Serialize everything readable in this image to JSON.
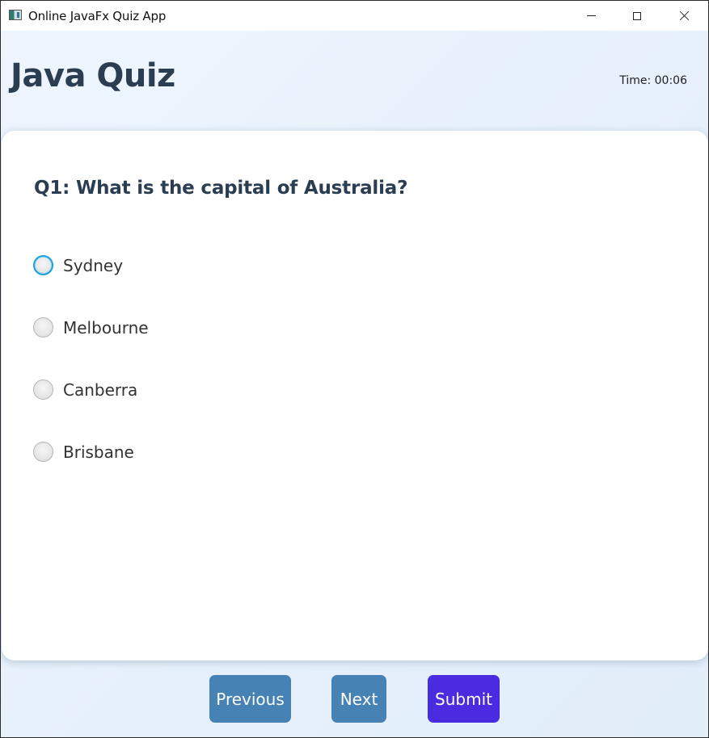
{
  "window": {
    "title": "Online JavaFx Quiz App",
    "icons": {
      "app": "app-icon",
      "minimize": "minimize-icon",
      "maximize": "maximize-icon",
      "close": "close-icon"
    }
  },
  "header": {
    "title": "Java Quiz",
    "timer": "Time: 00:06"
  },
  "question": {
    "text": "Q1: What is the capital of Australia?",
    "options": [
      {
        "label": "Sydney",
        "focused": true,
        "selected": false
      },
      {
        "label": "Melbourne",
        "focused": false,
        "selected": false
      },
      {
        "label": "Canberra",
        "focused": false,
        "selected": false
      },
      {
        "label": "Brisbane",
        "focused": false,
        "selected": false
      }
    ]
  },
  "actions": {
    "previous": "Previous",
    "next": "Next",
    "submit": "Submit"
  },
  "colors": {
    "nav_button": "#4682b4",
    "submit_button": "#4a2be0",
    "title_text": "#2b3d51",
    "focus_ring": "#1aa3d9"
  }
}
